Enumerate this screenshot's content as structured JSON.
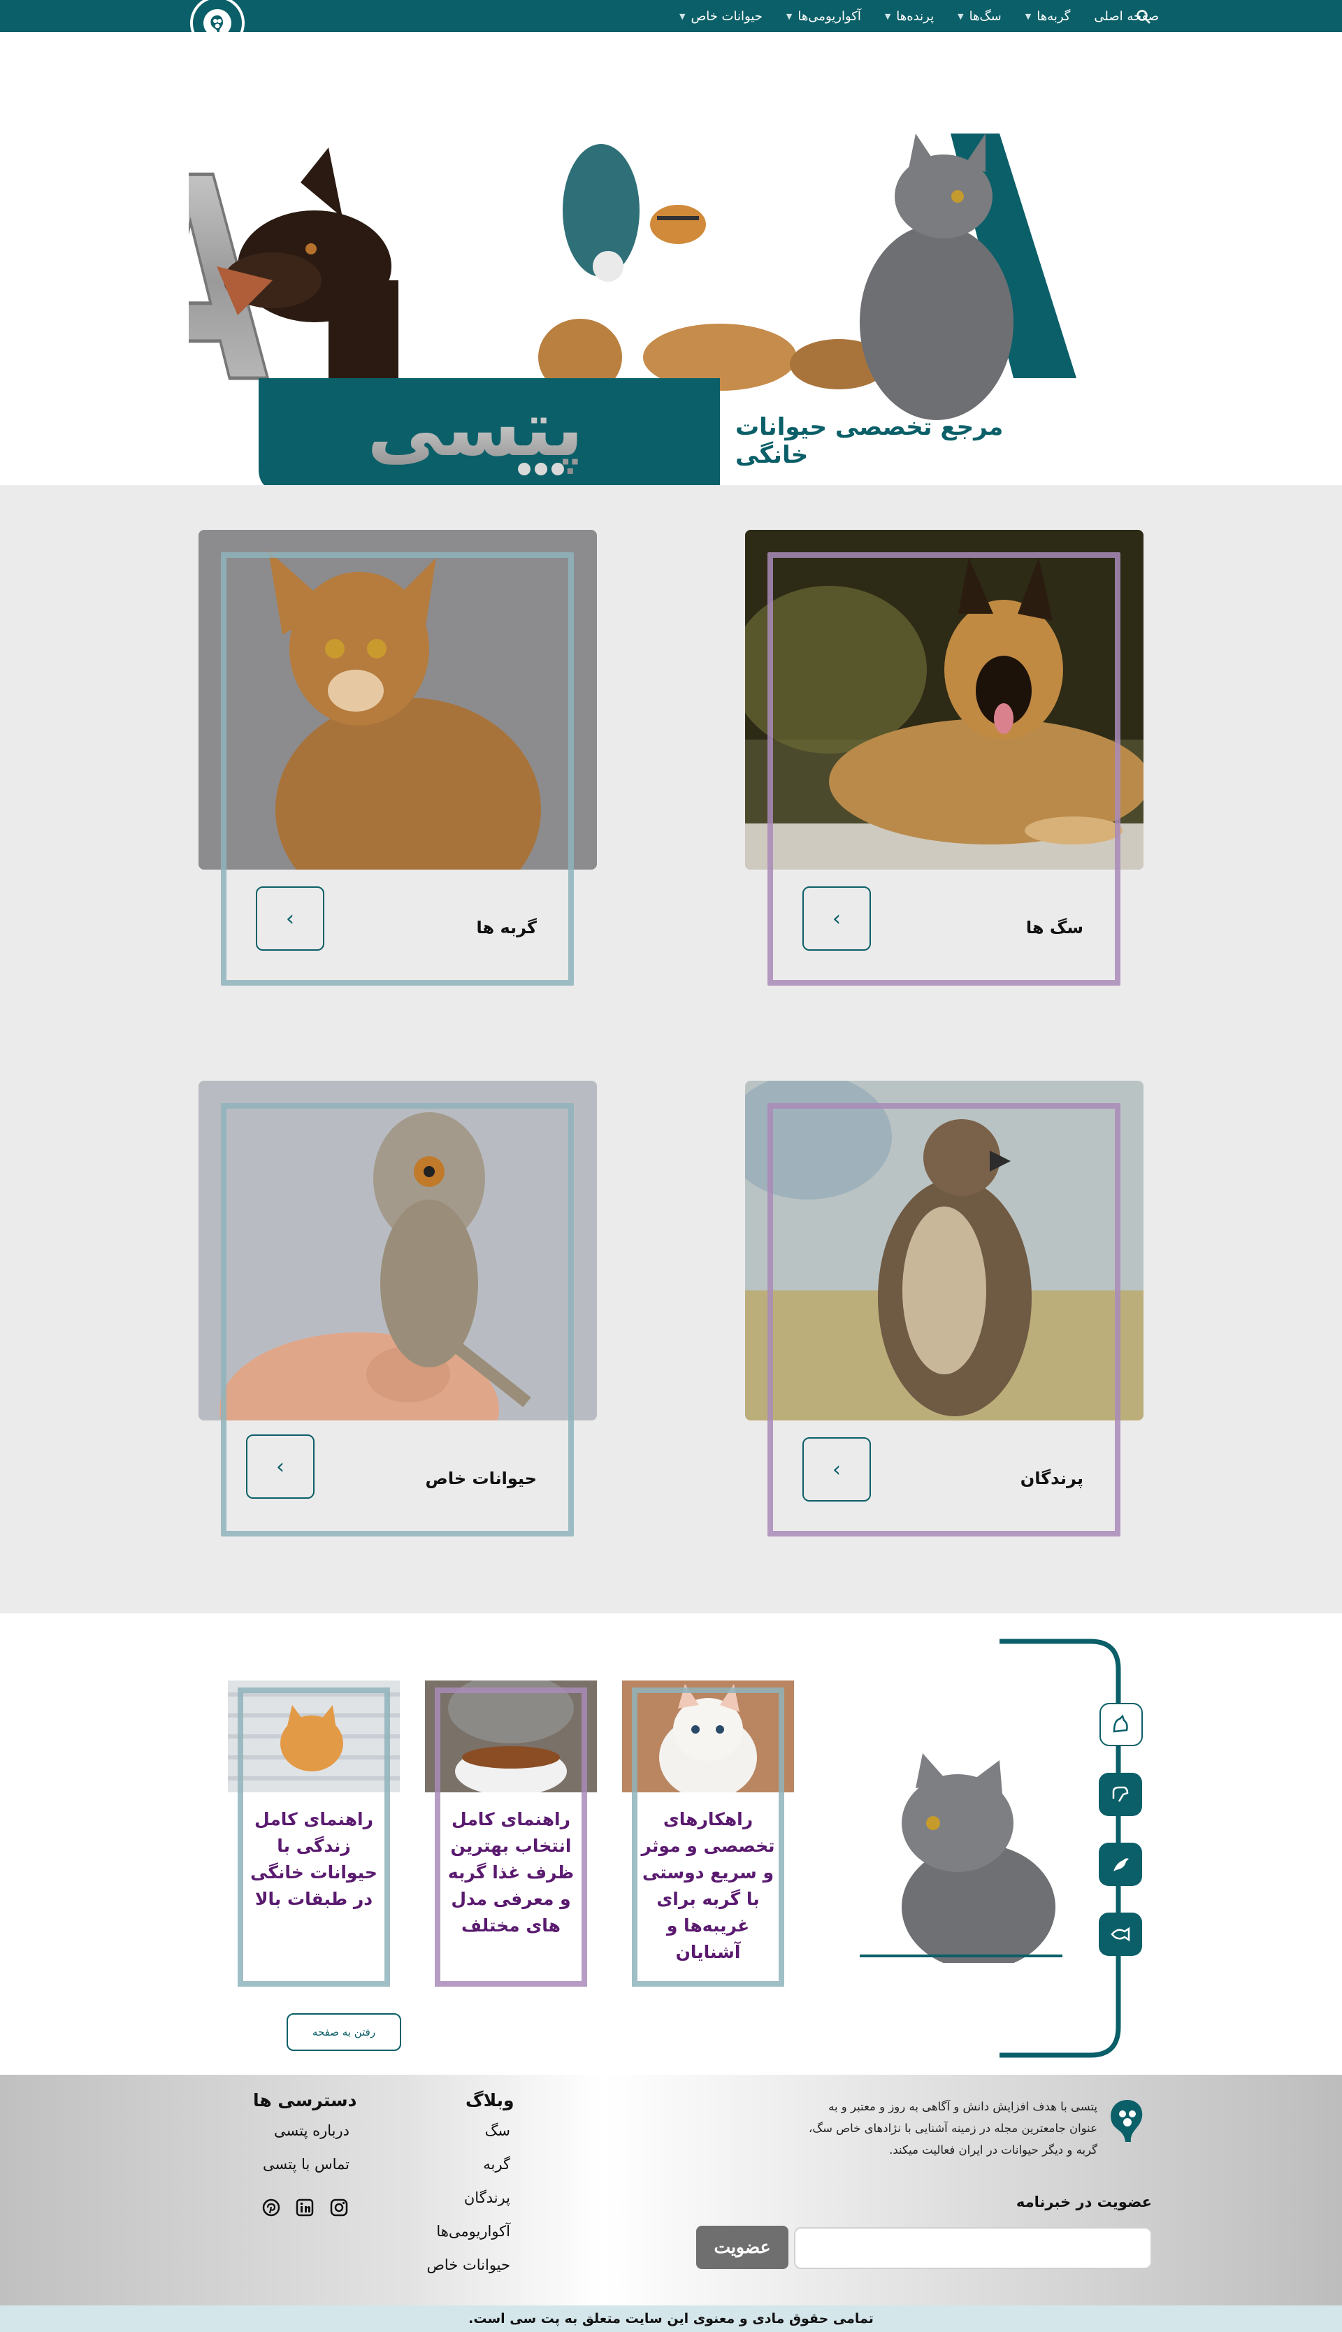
{
  "nav": {
    "items": [
      {
        "label": "صفحه اصلی",
        "has_dropdown": false
      },
      {
        "label": "گربه‌ها",
        "has_dropdown": true
      },
      {
        "label": "سگ‌ها",
        "has_dropdown": true
      },
      {
        "label": "پرنده‌ها",
        "has_dropdown": true
      },
      {
        "label": "آکواریومی‌ها",
        "has_dropdown": true
      },
      {
        "label": "حیوانات خاص",
        "has_dropdown": true
      }
    ],
    "search_icon": "search-icon",
    "logo_icon": "paw-icon"
  },
  "hero": {
    "logo_latin": "PETSEA",
    "logo_persian": "پتسی",
    "tagline": "مرجع تخصصی حیوانات خانگی"
  },
  "categories": [
    {
      "label": "سگ ها",
      "image": "german-shepherd-dog",
      "frame_color": "#a98bb9"
    },
    {
      "label": "گربه ها",
      "image": "abyssinian-cat",
      "frame_color": "#8fb3bb"
    },
    {
      "label": "پرندگان",
      "image": "hawk-bird",
      "frame_color": "#a98bb9"
    },
    {
      "label": "حیوانات خاص",
      "image": "chameleon-on-hand",
      "frame_color": "#8fb3bb"
    }
  ],
  "blog": {
    "rail_icons": [
      "cat-icon",
      "dog-icon",
      "bird-icon",
      "fish-icon"
    ],
    "feature_image": "gray-cat-looking-up",
    "posts": [
      {
        "title": "راهکارهای تخصصی و موثر و سریع دوستی با گربه برای غریبه‌ها و آشنایان",
        "image": "white-kitten",
        "frame_color": "#8fb3bb"
      },
      {
        "title": "راهنمای کامل انتخاب بهترین ظرف غذا گربه و معرفی مدل های مختلف",
        "image": "cat-eating-bowl",
        "frame_color": "#a98bb9"
      },
      {
        "title": "راهنمای کامل زندگی با حیوانات خانگی در طبقات بالا",
        "image": "orange-kitten-blinds",
        "frame_color": "#8fb3bb"
      }
    ],
    "more_button": "رفتن به صفحه"
  },
  "footer": {
    "about": "پتسی با هدف افزایش دانش و آگاهی به روز و معتبر و به عنوان جامعترین مجله در زمینه آشنایی با نژادهای خاص سگ، گربه و دیگر حیوانات در ایران فعالیت میکند.",
    "newsletter_label": "عضویت در خبرنامه",
    "newsletter_placeholder": "",
    "subscribe_button": "عضویت",
    "blog_title": "وبلاگ",
    "blog_links": [
      "سگ",
      "گربه",
      "پرندگان",
      "آکواریومی‌ها",
      "حیوانات خاص"
    ],
    "access_title": "دسترسی ها",
    "access_links": [
      "درباره پتسی",
      "تماس با پتسی"
    ],
    "social_icons": [
      "instagram-icon",
      "linkedin-icon",
      "pinterest-icon"
    ]
  },
  "copyright": "تمامی حقوق مادی و معنوی این سایت متعلق به پت سی است.",
  "colors": {
    "brand": "#0b5f68",
    "purple": "#a98bb9",
    "teal_light": "#8fb3bb",
    "blog_title": "#5a1a6f"
  }
}
